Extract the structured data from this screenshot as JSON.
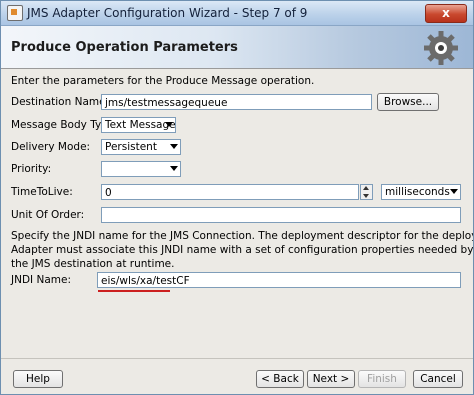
{
  "window": {
    "title": "JMS Adapter Configuration Wizard - Step 7 of 9",
    "close_label": "x"
  },
  "banner": {
    "heading": "Produce Operation Parameters",
    "icon": "gear-icon"
  },
  "intro_text": "Enter the parameters for the Produce Message operation.",
  "fields": {
    "destination_name": {
      "label": "Destination Name:",
      "value": "jms/testmessagequeue",
      "browse_label": "Browse..."
    },
    "message_body_type": {
      "label": "Message Body Type:",
      "value": "Text Message"
    },
    "delivery_mode": {
      "label": "Delivery Mode:",
      "value": "Persistent"
    },
    "priority": {
      "label": "Priority:",
      "value": ""
    },
    "time_to_live": {
      "label": "TimeToLive:",
      "value": "0",
      "unit": "milliseconds"
    },
    "unit_of_order": {
      "label": "Unit Of Order:",
      "value": ""
    }
  },
  "jndi_description": [
    "Specify the JNDI name for the JMS Connection.  The deployment descriptor for the deployed instance of the JMS",
    "Adapter must associate this JNDI name with a set of configuration properties needed by the JMS Adapter to access",
    "the JMS destination at runtime."
  ],
  "jndi": {
    "label": "JNDI Name:",
    "value": "eis/wls/xa/testCF"
  },
  "footer": {
    "help_label": "Help",
    "back_label": "< Back",
    "next_label": "Next >",
    "finish_label": "Finish",
    "cancel_label": "Cancel"
  },
  "colors": {
    "highlight_underline": "#cc1f1f",
    "title_bar": "#bcd2ea"
  }
}
